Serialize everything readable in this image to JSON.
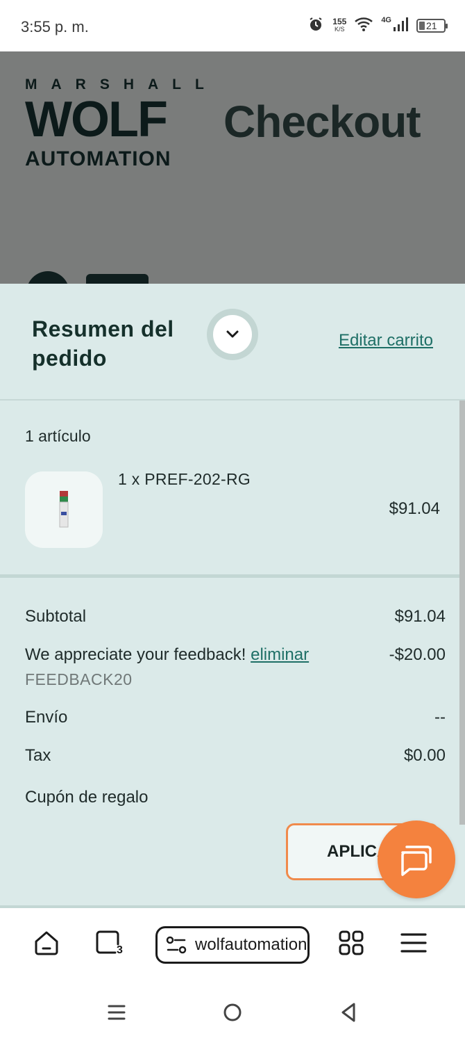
{
  "status_bar": {
    "time": "3:55 p. m.",
    "speed_value": "155",
    "speed_unit": "K/S",
    "network": "4G",
    "battery": "21",
    "icons": [
      "alarm-icon",
      "wifi-icon",
      "signal-icon",
      "battery-icon"
    ]
  },
  "page": {
    "logo": {
      "top": "MARSHALL",
      "middle": "WOLF",
      "bottom": "AUTOMATION"
    },
    "title": "Checkout"
  },
  "summary": {
    "title": "Resumen del pedido",
    "edit_link": "Editar carrito",
    "items_count": "1 artículo",
    "item": {
      "name": "1 x PREF-202-RG",
      "price": "$91.04"
    },
    "subtotal_label": "Subtotal",
    "subtotal_value": "$91.04",
    "discount_label": "We appreciate your feedback!",
    "discount_remove": "eliminar",
    "discount_value": "-$20.00",
    "discount_code": "FEEDBACK20",
    "shipping_label": "Envío",
    "shipping_value": "--",
    "tax_label": "Tax",
    "tax_value": "$0.00",
    "gift_label": "Cupón de regalo",
    "apply_button": "APLICAR"
  },
  "browser": {
    "url": "wolfautomation",
    "tabs_count": "3"
  },
  "colors": {
    "accent": "#1e6f66",
    "panel": "#dbeae9",
    "orange": "#f4823e",
    "overlay": "#7a7c7b"
  }
}
